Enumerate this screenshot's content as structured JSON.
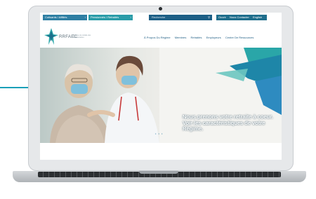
{
  "topbar": {
    "pill1": "Cotisants / Affiliés",
    "pill2": "Pensionnés / Retraités",
    "search_placeholder": "Recherche",
    "links": [
      "Ouvrir",
      "Nous Contacter",
      "English"
    ]
  },
  "brand": {
    "name": "RRFAEC",
    "subtitle": "Régime de retraite des fonctionnaires"
  },
  "menu": {
    "items": [
      "À Propos Du Régime",
      "Membres",
      "Retraités",
      "Employeurs",
      "Centre De Ressources"
    ]
  },
  "hero": {
    "headline": "Nous prenons votre retraite à coeur. Voir les caractéristiques de votre Régime."
  },
  "colors": {
    "accent_blue": "#2e7fa3",
    "accent_teal": "#2a9ca8",
    "nav_text": "#1f5e84"
  }
}
